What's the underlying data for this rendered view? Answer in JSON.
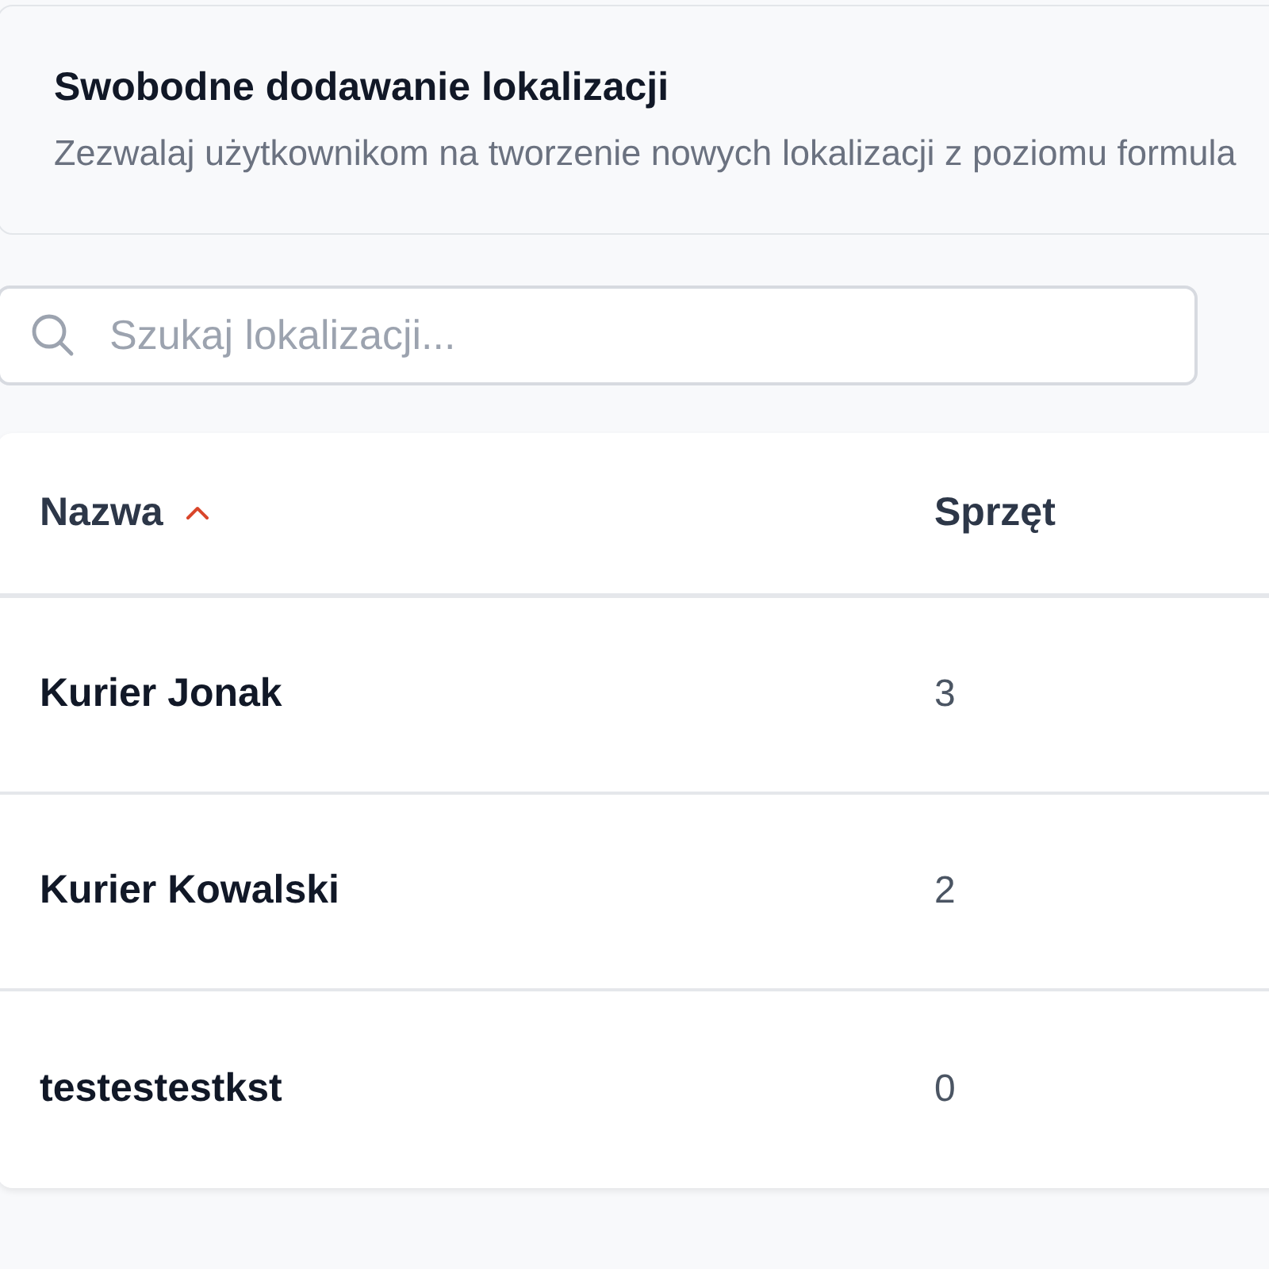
{
  "settings_card": {
    "title": "Swobodne dodawanie lokalizacji",
    "description": "Zezwalaj użytkownikom na tworzenie nowych lokalizacji z poziomu formula"
  },
  "search": {
    "placeholder": "Szukaj lokalizacji..."
  },
  "table": {
    "columns": [
      {
        "label": "Nazwa",
        "sorted": true
      },
      {
        "label": "Sprzęt",
        "sorted": false
      }
    ],
    "rows": [
      {
        "cells": [
          "Kurier Jonak",
          "3"
        ]
      },
      {
        "cells": [
          "Kurier Kowalski",
          "2"
        ]
      },
      {
        "cells": [
          "testestestkst",
          "0"
        ]
      }
    ]
  }
}
